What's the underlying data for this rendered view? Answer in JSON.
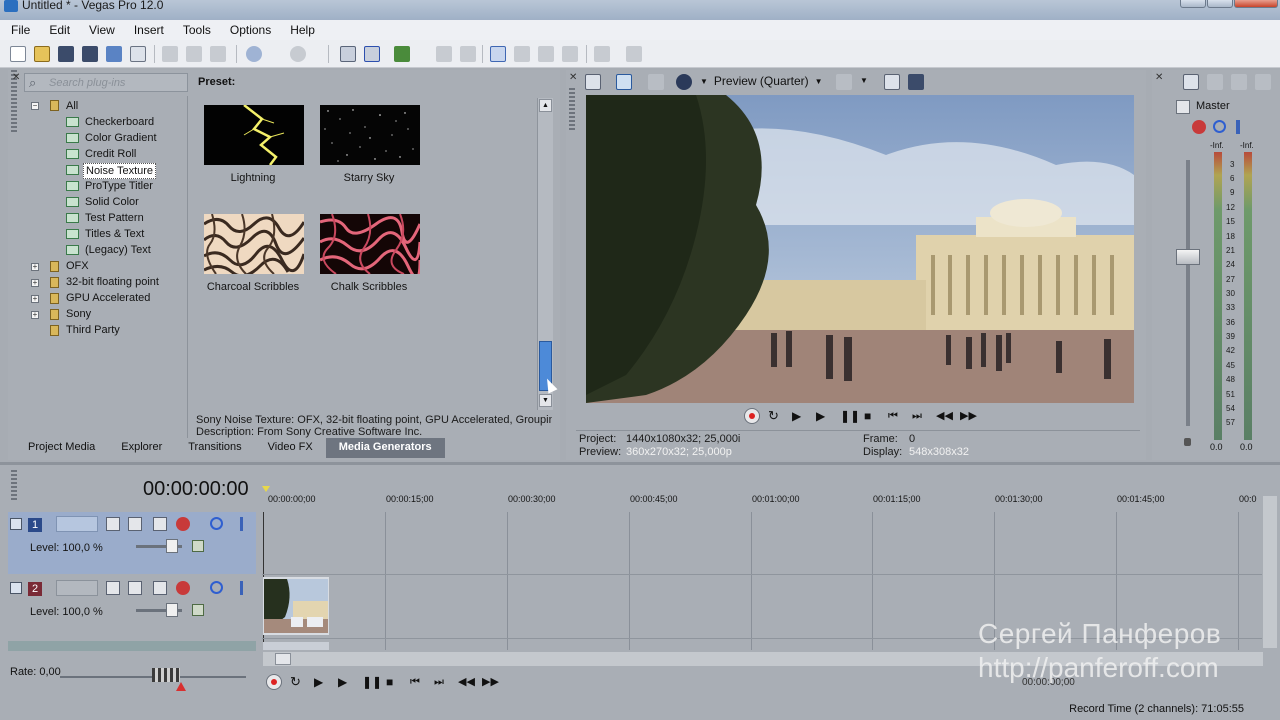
{
  "window": {
    "title": "Untitled * - Vegas Pro 12.0"
  },
  "menu": [
    "File",
    "Edit",
    "View",
    "Insert",
    "Tools",
    "Options",
    "Help"
  ],
  "media_generators": {
    "search_placeholder": "Search plug-ins",
    "preset_label": "Preset:",
    "tree": {
      "root": "All",
      "generators": [
        "Checkerboard",
        "Color Gradient",
        "Credit Roll",
        "Noise Texture",
        "ProType Titler",
        "Solid Color",
        "Test Pattern",
        "Titles & Text",
        "(Legacy) Text"
      ],
      "selected": "Noise Texture",
      "groups": [
        "OFX",
        "32-bit floating point",
        "GPU Accelerated",
        "Sony",
        "Third Party"
      ]
    },
    "presets": [
      "Lightning",
      "Starry Sky",
      "Charcoal Scribbles",
      "Chalk Scribbles"
    ],
    "info_line1": "Sony Noise Texture: OFX, 32-bit floating point, GPU Accelerated, Grouping",
    "info_line2": "Description: From Sony Creative Software Inc.",
    "tabs": [
      "Project Media",
      "Explorer",
      "Transitions",
      "Video FX",
      "Media Generators"
    ],
    "active_tab": "Media Generators"
  },
  "preview": {
    "quality": "Preview (Quarter)",
    "project_label": "Project:",
    "project_value": "1440x1080x32; 25,000i",
    "preview_label": "Preview:",
    "preview_value": "360x270x32; 25,000p",
    "frame_label": "Frame:",
    "frame_value": "0",
    "display_label": "Display:",
    "display_value": "548x308x32"
  },
  "master": {
    "label": "Master",
    "inf_left": "-Inf.",
    "inf_right": "-Inf.",
    "scale": [
      "3",
      "6",
      "9",
      "12",
      "15",
      "18",
      "21",
      "24",
      "27",
      "30",
      "33",
      "36",
      "39",
      "42",
      "45",
      "48",
      "51",
      "54",
      "57"
    ],
    "readout_left": "0.0",
    "readout_right": "0.0"
  },
  "timeline": {
    "timecode": "00:00:00:00",
    "ruler": [
      "00:00:00;00",
      "00:00:15;00",
      "00:00:30;00",
      "00:00:45;00",
      "00:01:00;00",
      "00:01:15;00",
      "00:01:30;00",
      "00:01:45;00",
      "00:0"
    ],
    "tracks": [
      {
        "number": "1",
        "level": "Level: 100,0 %"
      },
      {
        "number": "2",
        "level": "Level: 100,0 %"
      }
    ],
    "rate": "Rate: 0,00",
    "bottom_timecode": "00:00:00;00"
  },
  "status": {
    "record_time": "Record Time (2 channels): 71:05:55"
  },
  "watermark": {
    "name": "Сергей Панферов",
    "url": "http://panferoff.com"
  }
}
